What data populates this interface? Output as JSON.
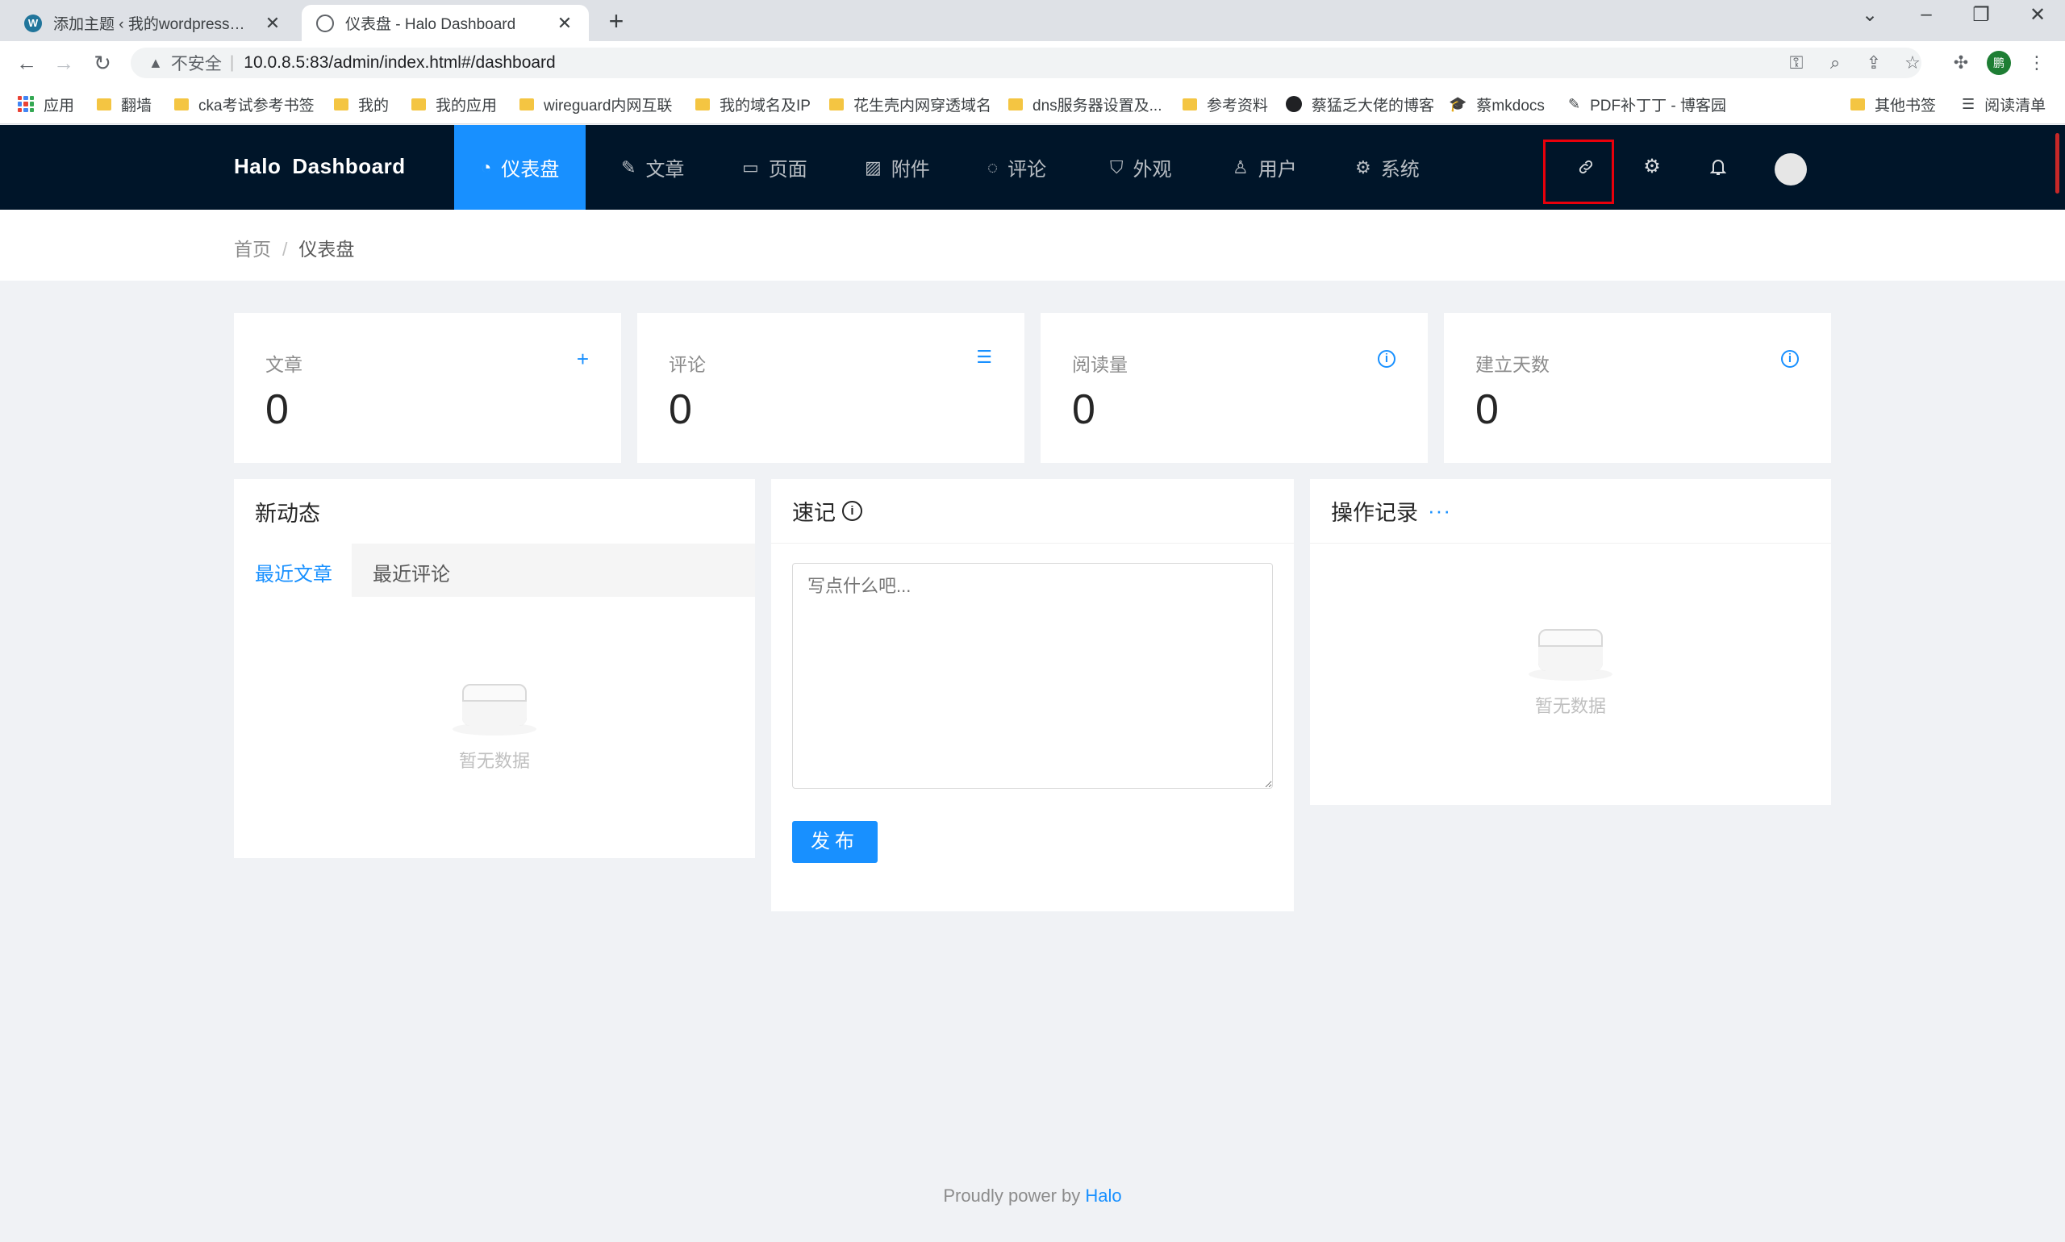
{
  "browser": {
    "tabs": [
      {
        "title": "添加主题 ‹ 我的wordpress网站 — WordPress",
        "active": false,
        "icon": "wordpress-icon"
      },
      {
        "title": "仪表盘 - Halo Dashboard",
        "active": true,
        "icon": "globe-icon"
      }
    ],
    "close_glyph": "✕",
    "new_tab_glyph": "+",
    "security_label": "不安全",
    "url": "10.0.8.5:83/admin/index.html#/dashboard",
    "profile_initial": "鹏",
    "bookmarks": [
      {
        "label": "应用",
        "icon": "apps-icon"
      },
      {
        "label": "翻墙",
        "icon": "folder-icon"
      },
      {
        "label": "cka考试参考书签",
        "icon": "folder-icon"
      },
      {
        "label": "我的",
        "icon": "folder-icon"
      },
      {
        "label": "我的应用",
        "icon": "folder-icon"
      },
      {
        "label": "wireguard内网互联",
        "icon": "folder-icon"
      },
      {
        "label": "我的域名及IP",
        "icon": "folder-icon"
      },
      {
        "label": "花生壳内网穿透域名",
        "icon": "folder-icon"
      },
      {
        "label": "dns服务器设置及...",
        "icon": "folder-icon"
      },
      {
        "label": "参考资料",
        "icon": "folder-icon"
      },
      {
        "label": "蔡猛乏大佬的博客",
        "icon": "github-icon"
      },
      {
        "label": "蔡mkdocs",
        "icon": "graduation-cap-icon"
      },
      {
        "label": "PDF补丁丁 - 博客园",
        "icon": "pen-icon"
      },
      {
        "label": "其他书签",
        "icon": "folder-icon"
      },
      {
        "label": "阅读清单",
        "icon": "reading-list-icon"
      }
    ]
  },
  "app": {
    "logo": [
      "Halo",
      "Dashboard"
    ],
    "menu": [
      {
        "label": "仪表盘",
        "icon": "dashboard-icon",
        "active": true
      },
      {
        "label": "文章",
        "icon": "edit-icon",
        "active": false
      },
      {
        "label": "页面",
        "icon": "book-icon",
        "active": false
      },
      {
        "label": "附件",
        "icon": "picture-icon",
        "active": false
      },
      {
        "label": "评论",
        "icon": "message-icon",
        "active": false
      },
      {
        "label": "外观",
        "icon": "skin-icon",
        "active": false
      },
      {
        "label": "用户",
        "icon": "user-icon",
        "active": false
      },
      {
        "label": "系统",
        "icon": "setting-icon",
        "active": false
      }
    ],
    "header_icons": [
      "link-icon",
      "setting-icon",
      "bell-icon",
      "avatar"
    ],
    "highlight_color": "#e8000b",
    "accent_color": "#1890ff",
    "header_bg": "#001529"
  },
  "breadcrumb": {
    "home": "首页",
    "separator": "/",
    "current": "仪表盘"
  },
  "stats": [
    {
      "label": "文章",
      "value": "0",
      "action_icon": "plus-icon",
      "action_glyph": "+"
    },
    {
      "label": "评论",
      "value": "0",
      "action_icon": "list-icon",
      "action_glyph": "☰"
    },
    {
      "label": "阅读量",
      "value": "0",
      "action_icon": "info-icon",
      "action_glyph": "i"
    },
    {
      "label": "建立天数",
      "value": "0",
      "action_icon": "info-icon",
      "action_glyph": "i"
    }
  ],
  "activity": {
    "title": "新动态",
    "tabs": [
      "最近文章",
      "最近评论"
    ],
    "active_tab": 0,
    "empty_text": "暂无数据"
  },
  "memo": {
    "title": "速记",
    "info_glyph": "i",
    "placeholder": "写点什么吧...",
    "publish_label": "发布"
  },
  "logs": {
    "title": "操作记录",
    "more_glyph": "···",
    "empty_text": "暂无数据"
  },
  "footer": {
    "text": "Proudly power by",
    "link": "Halo"
  }
}
